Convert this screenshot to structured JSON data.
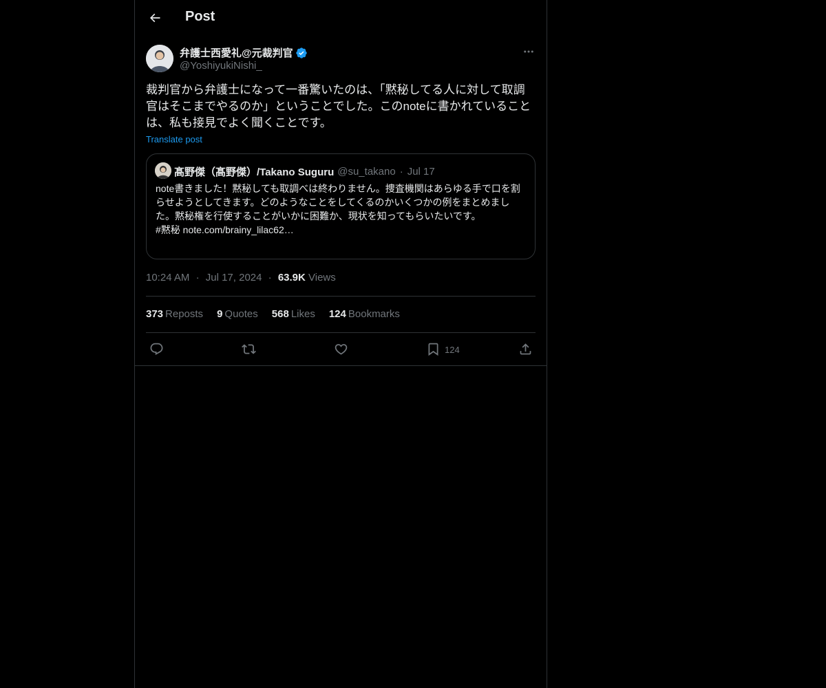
{
  "header": {
    "title": "Post",
    "back_icon": "arrow-left-icon"
  },
  "author": {
    "name": "弁護士西愛礼@元裁判官",
    "handle": "@YoshiyukiNishi_",
    "verified": true
  },
  "post": {
    "text": "裁判官から弁護士になって一番驚いたのは、「黙秘してる人に対して取調官はそこまでやるのか」ということでした。このnoteに書かれていることは、私も接見でよく聞くことです。",
    "translate_label": "Translate post"
  },
  "quote": {
    "name": "髙野傑（髙野傑）/Takano Suguru",
    "handle": "@su_takano",
    "separator": "·",
    "date": "Jul 17",
    "text": "note書きました！黙秘しても取調べは終わりません。捜査機関はあらゆる手で口を割らせようとしてきます。どのようなことをしてくるのかいくつかの例をまとめました。黙秘権を行使することがいかに困難か、現状を知ってもらいたいです。",
    "link_line": "#黙秘 note.com/brainy_lilac62…"
  },
  "meta": {
    "time": "10:24 AM",
    "separator": "·",
    "date": "Jul 17, 2024",
    "views_count": "63.9K",
    "views_label": "Views"
  },
  "stats": [
    {
      "count": "373",
      "label": "Reposts"
    },
    {
      "count": "9",
      "label": "Quotes"
    },
    {
      "count": "568",
      "label": "Likes"
    },
    {
      "count": "124",
      "label": "Bookmarks"
    }
  ],
  "actions": {
    "reply_icon": "reply-icon",
    "repost_icon": "repost-icon",
    "like_icon": "heart-icon",
    "bookmark_icon": "bookmark-icon",
    "bookmark_count": "124",
    "share_icon": "share-icon"
  },
  "colors": {
    "background": "#000000",
    "text": "#e7e9ea",
    "secondary_text": "#71767b",
    "accent": "#1d9bf0",
    "border": "#2f3336"
  }
}
